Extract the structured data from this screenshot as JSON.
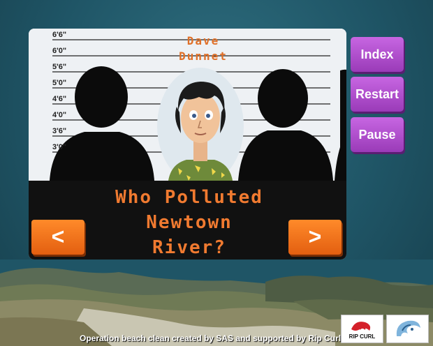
{
  "ruler": {
    "marks": [
      "6'6\"",
      "6'0\"",
      "5'6\"",
      "5'0\"",
      "4'6\"",
      "4'0\"",
      "3'6\"",
      "3'0\""
    ]
  },
  "suspect": {
    "name_line1": "Dave",
    "name_line2": "Dunnet"
  },
  "question": {
    "line1": "Who Polluted",
    "line2": "Newtown",
    "line3": "River?"
  },
  "nav": {
    "prev_label": "<",
    "next_label": ">"
  },
  "menu": {
    "index_label": "Index",
    "restart_label": "Restart",
    "pause_label": "Pause"
  },
  "footer": {
    "credit": "Operation beach clean created by SAS and supported by Rip Curl"
  },
  "logos": {
    "ripcurl_icon": "ripcurl-logo",
    "sas_icon": "sas-wave-logo",
    "ripcurl_text": "RIP CURL"
  },
  "colors": {
    "background": "#1f5566",
    "accent_orange": "#f07a30",
    "button_purple": "#b050d0"
  }
}
